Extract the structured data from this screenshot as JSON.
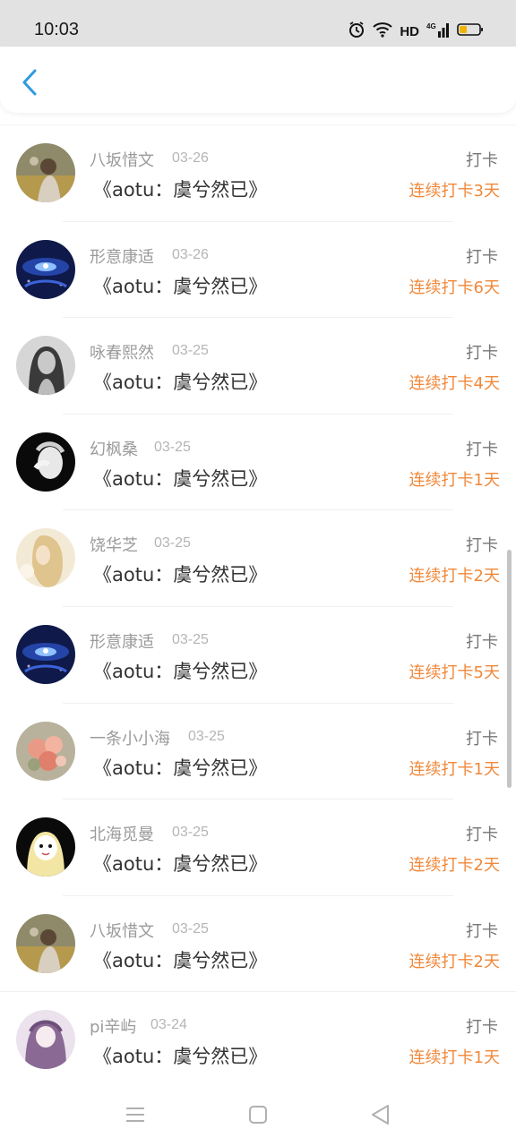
{
  "status_bar": {
    "time": "10:03",
    "network": "HD",
    "cell": "4G"
  },
  "colors": {
    "accent": "#f0883a",
    "back": "#2e9ae0"
  },
  "entries": [
    {
      "name": "八坂惜文",
      "date": "03-26",
      "book": "《aotu：虞兮然已》",
      "action": "打卡",
      "streak": "连续打卡3天"
    },
    {
      "name": "形意康适",
      "date": "03-26",
      "book": "《aotu：虞兮然已》",
      "action": "打卡",
      "streak": "连续打卡6天"
    },
    {
      "name": "咏春熙然",
      "date": "03-25",
      "book": "《aotu：虞兮然已》",
      "action": "打卡",
      "streak": "连续打卡4天"
    },
    {
      "name": "幻枫桑",
      "date": "03-25",
      "book": "《aotu：虞兮然已》",
      "action": "打卡",
      "streak": "连续打卡1天"
    },
    {
      "name": "饶华芝",
      "date": "03-25",
      "book": "《aotu：虞兮然已》",
      "action": "打卡",
      "streak": "连续打卡2天"
    },
    {
      "name": "形意康适",
      "date": "03-25",
      "book": "《aotu：虞兮然已》",
      "action": "打卡",
      "streak": "连续打卡5天"
    },
    {
      "name": "一条小小海",
      "date": "03-25",
      "book": "《aotu：虞兮然已》",
      "action": "打卡",
      "streak": "连续打卡1天"
    },
    {
      "name": "北海觅曼",
      "date": "03-25",
      "book": "《aotu：虞兮然已》",
      "action": "打卡",
      "streak": "连续打卡2天"
    },
    {
      "name": "八坂惜文",
      "date": "03-25",
      "book": "《aotu：虞兮然已》",
      "action": "打卡",
      "streak": "连续打卡2天"
    },
    {
      "name": "pi辛屿",
      "date": "03-24",
      "book": "《aotu：虞兮然已》",
      "action": "打卡",
      "streak": "连续打卡1天"
    }
  ]
}
